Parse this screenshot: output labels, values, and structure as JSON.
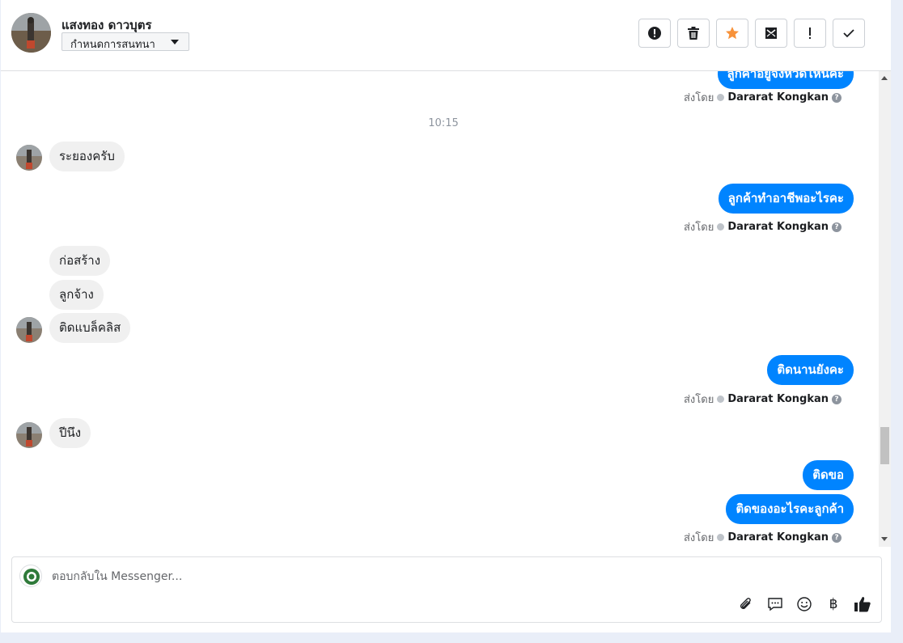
{
  "header": {
    "customer_name": "แสงทอง ดาวบุตร",
    "assign_label": "กำหนดการสนทนา",
    "tools": [
      {
        "name": "report-spam-button",
        "icon": "alert-circle-icon"
      },
      {
        "name": "delete-button",
        "icon": "trash-icon"
      },
      {
        "name": "star-button",
        "icon": "star-icon"
      },
      {
        "name": "mark-unread-button",
        "icon": "envelope-icon"
      },
      {
        "name": "follow-up-button",
        "icon": "exclamation-icon"
      },
      {
        "name": "mark-done-button",
        "icon": "check-icon"
      }
    ],
    "star_color": "#f7923a"
  },
  "conversation": {
    "top_partial_text": "ลูกค้าอยู่จังหวัดไหนคะ",
    "sent_by_prefix": "ส่งโดย",
    "agent_name": "Dararat Kongkan",
    "help_glyph": "?",
    "timestamp": "10:15",
    "messages": [
      {
        "dir": "in",
        "text": "ระยองครับ"
      },
      {
        "dir": "out",
        "text": "ลูกค้าทำอาชีพอะไรคะ"
      },
      {
        "dir": "in",
        "text": "ก่อสร้าง"
      },
      {
        "dir": "in",
        "text": "ลูกจ้าง"
      },
      {
        "dir": "in",
        "text": "ติดแบล็คลิส"
      },
      {
        "dir": "out",
        "text": "ติดนานยังคะ"
      },
      {
        "dir": "in",
        "text": "ปีนึง"
      },
      {
        "dir": "out",
        "text": "ติดขอ"
      },
      {
        "dir": "out",
        "text": "ติดของอะไรคะลูกค้า"
      }
    ],
    "outgoing_color": "#0084ff",
    "incoming_color": "#f0f0f0"
  },
  "composer": {
    "placeholder": "ตอบกลับใน Messenger...",
    "currency_glyph": "฿",
    "icons": [
      "paperclip-icon",
      "saved-reply-icon",
      "emoji-icon",
      "baht-icon",
      "thumbs-up-icon"
    ]
  }
}
